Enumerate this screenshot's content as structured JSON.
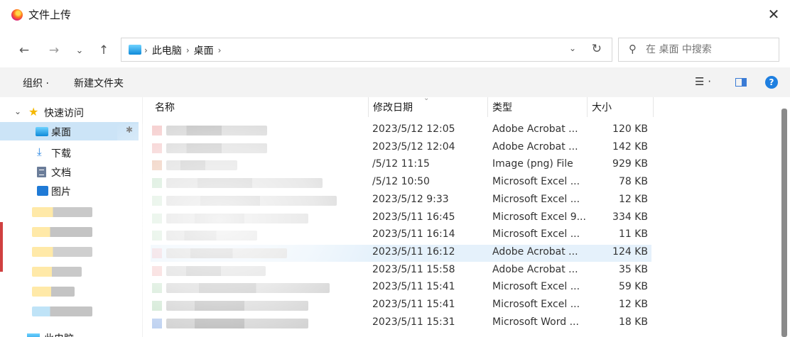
{
  "window": {
    "title": "文件上传",
    "close_glyph": "✕"
  },
  "nav": {
    "back_glyph": "←",
    "forward_glyph": "→",
    "recent_glyph": "⌄",
    "up_glyph": "↑",
    "crumbs": [
      "此电脑",
      "桌面"
    ],
    "crumb_sep": "›",
    "dropdown_glyph": "⌄",
    "refresh_glyph": "↻",
    "search_placeholder": "在 桌面 中搜索"
  },
  "toolbar": {
    "organize_label": "组织 ·",
    "new_folder_label": "新建文件夹",
    "view_glyph": "☰ ·",
    "help_glyph": "?"
  },
  "sidebar": {
    "quick_access": "快速访问",
    "items": [
      {
        "label": "桌面",
        "icon": "desktop-icon",
        "selected": true
      },
      {
        "label": "下载",
        "icon": "download-icon",
        "selected": false
      },
      {
        "label": "文档",
        "icon": "document-icon",
        "selected": false
      },
      {
        "label": "图片",
        "icon": "pictures-icon",
        "selected": false
      }
    ],
    "this_pc": "此电脑",
    "pin_glyph": "✱",
    "chev_glyph": "⌄"
  },
  "columns": {
    "name": "名称",
    "date": "修改日期",
    "type": "类型",
    "size": "大小",
    "sort_glyph": "⌄"
  },
  "files": [
    {
      "date": "2023/5/12 12:05",
      "type": "Adobe Acrobat ...",
      "size": "120 KB"
    },
    {
      "date": "2023/5/12 12:04",
      "type": "Adobe Acrobat ...",
      "size": "142 KB"
    },
    {
      "date": "/5/12 11:15",
      "type": "Image (png) File",
      "size": "929 KB"
    },
    {
      "date": "/5/12 10:50",
      "type": "Microsoft Excel ...",
      "size": "78 KB"
    },
    {
      "date": "2023/5/12 9:33",
      "type": "Microsoft Excel ...",
      "size": "12 KB"
    },
    {
      "date": "2023/5/11 16:45",
      "type": "Microsoft Excel 9...",
      "size": "334 KB"
    },
    {
      "date": "2023/5/11 16:14",
      "type": "Microsoft Excel ...",
      "size": "11 KB"
    },
    {
      "date": "2023/5/11 16:12",
      "type": "Adobe Acrobat ...",
      "size": "124 KB",
      "highlighted": true
    },
    {
      "date": "2023/5/11 15:58",
      "type": "Adobe Acrobat ...",
      "size": "35 KB"
    },
    {
      "date": "2023/5/11 15:41",
      "type": "Microsoft Excel ...",
      "size": "59 KB"
    },
    {
      "date": "2023/5/11 15:41",
      "type": "Microsoft Excel ...",
      "size": "12 KB"
    },
    {
      "date": "2023/5/11 15:31",
      "type": "Microsoft Word ...",
      "size": "18 KB"
    }
  ],
  "colors": {
    "selection": "#cce4f7",
    "hover": "#e5f1fb",
    "accent": "#1e7fe0"
  }
}
